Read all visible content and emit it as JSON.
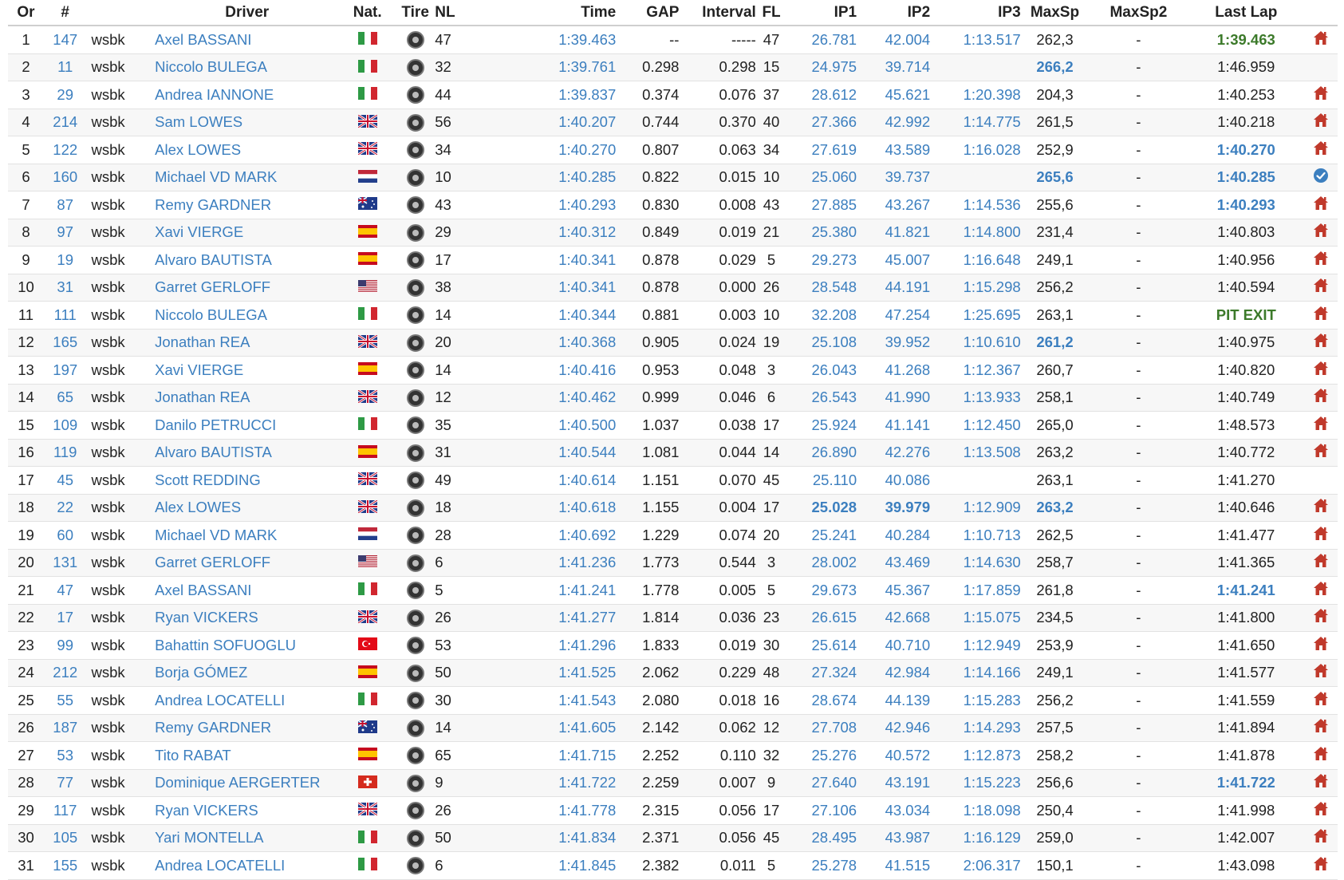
{
  "headers": [
    "Or",
    "#",
    "",
    "Driver",
    "Nat.",
    "Tire",
    "NL",
    "Time",
    "GAP",
    "Interval",
    "FL",
    "IP1",
    "IP2",
    "IP3",
    "MaxSp",
    "MaxSp2",
    "Last Lap",
    ""
  ],
  "colors": {
    "link": "#3c7fbf",
    "green": "#3c7a2a",
    "home": "#c0392b",
    "check": "#3c7fbf"
  },
  "flags": {
    "IT": [
      "#2e9a45",
      "#ffffff",
      "#d1262f"
    ],
    "GB": "gb",
    "NL": [
      "#c0283a",
      "#ffffff",
      "#233f8c"
    ],
    "AU": "au",
    "ES": [
      "#c60b1e",
      "#ffc400",
      "#c60b1e"
    ],
    "US": "us",
    "TR": "tr",
    "CH": "ch"
  },
  "rows": [
    {
      "pos": "1",
      "num": "147",
      "cat": "wsbk",
      "driver": "Axel BASSANI",
      "nat": "IT",
      "nl": "47",
      "time": "1:39.463",
      "gap": "--",
      "interval": "-----",
      "fl": "47",
      "ip1": "26.781",
      "ip2": "42.004",
      "ip3": "1:13.517",
      "maxsp": "262,3",
      "maxsp2": "-",
      "lastlap": "1:39.463",
      "ll_style": "green",
      "ms_style": "",
      "ip1_style": "",
      "ip2_style": "",
      "icon": "home-icon"
    },
    {
      "pos": "2",
      "num": "11",
      "cat": "wsbk",
      "driver": "Niccolo BULEGA",
      "nat": "IT",
      "nl": "32",
      "time": "1:39.761",
      "gap": "0.298",
      "interval": "0.298",
      "fl": "15",
      "ip1": "24.975",
      "ip2": "39.714",
      "ip3": "",
      "maxsp": "266,2",
      "maxsp2": "-",
      "lastlap": "1:46.959",
      "ll_style": "",
      "ms_style": "hl",
      "ip1_style": "",
      "ip2_style": "",
      "icon": ""
    },
    {
      "pos": "3",
      "num": "29",
      "cat": "wsbk",
      "driver": "Andrea IANNONE",
      "nat": "IT",
      "nl": "44",
      "time": "1:39.837",
      "gap": "0.374",
      "interval": "0.076",
      "fl": "37",
      "ip1": "28.612",
      "ip2": "45.621",
      "ip3": "1:20.398",
      "maxsp": "204,3",
      "maxsp2": "-",
      "lastlap": "1:40.253",
      "ll_style": "",
      "ms_style": "",
      "ip1_style": "",
      "ip2_style": "",
      "icon": "home-icon"
    },
    {
      "pos": "4",
      "num": "214",
      "cat": "wsbk",
      "driver": "Sam LOWES",
      "nat": "GB",
      "nl": "56",
      "time": "1:40.207",
      "gap": "0.744",
      "interval": "0.370",
      "fl": "40",
      "ip1": "27.366",
      "ip2": "42.992",
      "ip3": "1:14.775",
      "maxsp": "261,5",
      "maxsp2": "-",
      "lastlap": "1:40.218",
      "ll_style": "",
      "ms_style": "",
      "ip1_style": "",
      "ip2_style": "",
      "icon": "home-icon"
    },
    {
      "pos": "5",
      "num": "122",
      "cat": "wsbk",
      "driver": "Alex LOWES",
      "nat": "GB",
      "nl": "34",
      "time": "1:40.270",
      "gap": "0.807",
      "interval": "0.063",
      "fl": "34",
      "ip1": "27.619",
      "ip2": "43.589",
      "ip3": "1:16.028",
      "maxsp": "252,9",
      "maxsp2": "-",
      "lastlap": "1:40.270",
      "ll_style": "hl",
      "ms_style": "",
      "ip1_style": "",
      "ip2_style": "",
      "icon": "home-icon"
    },
    {
      "pos": "6",
      "num": "160",
      "cat": "wsbk",
      "driver": "Michael VD MARK",
      "nat": "NL",
      "nl": "10",
      "time": "1:40.285",
      "gap": "0.822",
      "interval": "0.015",
      "fl": "10",
      "ip1": "25.060",
      "ip2": "39.737",
      "ip3": "",
      "maxsp": "265,6",
      "maxsp2": "-",
      "lastlap": "1:40.285",
      "ll_style": "hl",
      "ms_style": "hl",
      "ip1_style": "",
      "ip2_style": "",
      "icon": "check-icon"
    },
    {
      "pos": "7",
      "num": "87",
      "cat": "wsbk",
      "driver": "Remy GARDNER",
      "nat": "AU",
      "nl": "43",
      "time": "1:40.293",
      "gap": "0.830",
      "interval": "0.008",
      "fl": "43",
      "ip1": "27.885",
      "ip2": "43.267",
      "ip3": "1:14.536",
      "maxsp": "255,6",
      "maxsp2": "-",
      "lastlap": "1:40.293",
      "ll_style": "hl",
      "ms_style": "",
      "ip1_style": "",
      "ip2_style": "",
      "icon": "home-icon"
    },
    {
      "pos": "8",
      "num": "97",
      "cat": "wsbk",
      "driver": "Xavi VIERGE",
      "nat": "ES",
      "nl": "29",
      "time": "1:40.312",
      "gap": "0.849",
      "interval": "0.019",
      "fl": "21",
      "ip1": "25.380",
      "ip2": "41.821",
      "ip3": "1:14.800",
      "maxsp": "231,4",
      "maxsp2": "-",
      "lastlap": "1:40.803",
      "ll_style": "",
      "ms_style": "",
      "ip1_style": "",
      "ip2_style": "",
      "icon": "home-icon"
    },
    {
      "pos": "9",
      "num": "19",
      "cat": "wsbk",
      "driver": "Alvaro BAUTISTA",
      "nat": "ES",
      "nl": "17",
      "time": "1:40.341",
      "gap": "0.878",
      "interval": "0.029",
      "fl": "5",
      "ip1": "29.273",
      "ip2": "45.007",
      "ip3": "1:16.648",
      "maxsp": "249,1",
      "maxsp2": "-",
      "lastlap": "1:40.956",
      "ll_style": "",
      "ms_style": "",
      "ip1_style": "",
      "ip2_style": "",
      "icon": "home-icon"
    },
    {
      "pos": "10",
      "num": "31",
      "cat": "wsbk",
      "driver": "Garret GERLOFF",
      "nat": "US",
      "nl": "38",
      "time": "1:40.341",
      "gap": "0.878",
      "interval": "0.000",
      "fl": "26",
      "ip1": "28.548",
      "ip2": "44.191",
      "ip3": "1:15.298",
      "maxsp": "256,2",
      "maxsp2": "-",
      "lastlap": "1:40.594",
      "ll_style": "",
      "ms_style": "",
      "ip1_style": "",
      "ip2_style": "",
      "icon": "home-icon"
    },
    {
      "pos": "11",
      "num": "111",
      "cat": "wsbk",
      "driver": "Niccolo BULEGA",
      "nat": "IT",
      "nl": "14",
      "time": "1:40.344",
      "gap": "0.881",
      "interval": "0.003",
      "fl": "10",
      "ip1": "32.208",
      "ip2": "47.254",
      "ip3": "1:25.695",
      "maxsp": "263,1",
      "maxsp2": "-",
      "lastlap": "PIT EXIT",
      "ll_style": "pit",
      "ms_style": "",
      "ip1_style": "",
      "ip2_style": "",
      "icon": "home-icon"
    },
    {
      "pos": "12",
      "num": "165",
      "cat": "wsbk",
      "driver": "Jonathan REA",
      "nat": "GB",
      "nl": "20",
      "time": "1:40.368",
      "gap": "0.905",
      "interval": "0.024",
      "fl": "19",
      "ip1": "25.108",
      "ip2": "39.952",
      "ip3": "1:10.610",
      "maxsp": "261,2",
      "maxsp2": "-",
      "lastlap": "1:40.975",
      "ll_style": "",
      "ms_style": "hl",
      "ip1_style": "",
      "ip2_style": "",
      "icon": "home-icon"
    },
    {
      "pos": "13",
      "num": "197",
      "cat": "wsbk",
      "driver": "Xavi VIERGE",
      "nat": "ES",
      "nl": "14",
      "time": "1:40.416",
      "gap": "0.953",
      "interval": "0.048",
      "fl": "3",
      "ip1": "26.043",
      "ip2": "41.268",
      "ip3": "1:12.367",
      "maxsp": "260,7",
      "maxsp2": "-",
      "lastlap": "1:40.820",
      "ll_style": "",
      "ms_style": "",
      "ip1_style": "",
      "ip2_style": "",
      "icon": "home-icon"
    },
    {
      "pos": "14",
      "num": "65",
      "cat": "wsbk",
      "driver": "Jonathan REA",
      "nat": "GB",
      "nl": "12",
      "time": "1:40.462",
      "gap": "0.999",
      "interval": "0.046",
      "fl": "6",
      "ip1": "26.543",
      "ip2": "41.990",
      "ip3": "1:13.933",
      "maxsp": "258,1",
      "maxsp2": "-",
      "lastlap": "1:40.749",
      "ll_style": "",
      "ms_style": "",
      "ip1_style": "",
      "ip2_style": "",
      "icon": "home-icon"
    },
    {
      "pos": "15",
      "num": "109",
      "cat": "wsbk",
      "driver": "Danilo PETRUCCI",
      "nat": "IT",
      "nl": "35",
      "time": "1:40.500",
      "gap": "1.037",
      "interval": "0.038",
      "fl": "17",
      "ip1": "25.924",
      "ip2": "41.141",
      "ip3": "1:12.450",
      "maxsp": "265,0",
      "maxsp2": "-",
      "lastlap": "1:48.573",
      "ll_style": "",
      "ms_style": "",
      "ip1_style": "",
      "ip2_style": "",
      "icon": "home-icon"
    },
    {
      "pos": "16",
      "num": "119",
      "cat": "wsbk",
      "driver": "Alvaro BAUTISTA",
      "nat": "ES",
      "nl": "31",
      "time": "1:40.544",
      "gap": "1.081",
      "interval": "0.044",
      "fl": "14",
      "ip1": "26.890",
      "ip2": "42.276",
      "ip3": "1:13.508",
      "maxsp": "263,2",
      "maxsp2": "-",
      "lastlap": "1:40.772",
      "ll_style": "",
      "ms_style": "",
      "ip1_style": "",
      "ip2_style": "",
      "icon": "home-icon"
    },
    {
      "pos": "17",
      "num": "45",
      "cat": "wsbk",
      "driver": "Scott REDDING",
      "nat": "GB",
      "nl": "49",
      "time": "1:40.614",
      "gap": "1.151",
      "interval": "0.070",
      "fl": "45",
      "ip1": "25.110",
      "ip2": "40.086",
      "ip3": "",
      "maxsp": "263,1",
      "maxsp2": "-",
      "lastlap": "1:41.270",
      "ll_style": "",
      "ms_style": "",
      "ip1_style": "",
      "ip2_style": "",
      "icon": ""
    },
    {
      "pos": "18",
      "num": "22",
      "cat": "wsbk",
      "driver": "Alex LOWES",
      "nat": "GB",
      "nl": "18",
      "time": "1:40.618",
      "gap": "1.155",
      "interval": "0.004",
      "fl": "17",
      "ip1": "25.028",
      "ip2": "39.979",
      "ip3": "1:12.909",
      "maxsp": "263,2",
      "maxsp2": "-",
      "lastlap": "1:40.646",
      "ll_style": "",
      "ms_style": "hl",
      "ip1_style": "hl",
      "ip2_style": "hl",
      "icon": "home-icon"
    },
    {
      "pos": "19",
      "num": "60",
      "cat": "wsbk",
      "driver": "Michael VD MARK",
      "nat": "NL",
      "nl": "28",
      "time": "1:40.692",
      "gap": "1.229",
      "interval": "0.074",
      "fl": "20",
      "ip1": "25.241",
      "ip2": "40.284",
      "ip3": "1:10.713",
      "maxsp": "262,5",
      "maxsp2": "-",
      "lastlap": "1:41.477",
      "ll_style": "",
      "ms_style": "",
      "ip1_style": "",
      "ip2_style": "",
      "icon": "home-icon"
    },
    {
      "pos": "20",
      "num": "131",
      "cat": "wsbk",
      "driver": "Garret GERLOFF",
      "nat": "US",
      "nl": "6",
      "time": "1:41.236",
      "gap": "1.773",
      "interval": "0.544",
      "fl": "3",
      "ip1": "28.002",
      "ip2": "43.469",
      "ip3": "1:14.630",
      "maxsp": "258,7",
      "maxsp2": "-",
      "lastlap": "1:41.365",
      "ll_style": "",
      "ms_style": "",
      "ip1_style": "",
      "ip2_style": "",
      "icon": "home-icon"
    },
    {
      "pos": "21",
      "num": "47",
      "cat": "wsbk",
      "driver": "Axel BASSANI",
      "nat": "IT",
      "nl": "5",
      "time": "1:41.241",
      "gap": "1.778",
      "interval": "0.005",
      "fl": "5",
      "ip1": "29.673",
      "ip2": "45.367",
      "ip3": "1:17.859",
      "maxsp": "261,8",
      "maxsp2": "-",
      "lastlap": "1:41.241",
      "ll_style": "hl",
      "ms_style": "",
      "ip1_style": "",
      "ip2_style": "",
      "icon": "home-icon"
    },
    {
      "pos": "22",
      "num": "17",
      "cat": "wsbk",
      "driver": "Ryan VICKERS",
      "nat": "GB",
      "nl": "26",
      "time": "1:41.277",
      "gap": "1.814",
      "interval": "0.036",
      "fl": "23",
      "ip1": "26.615",
      "ip2": "42.668",
      "ip3": "1:15.075",
      "maxsp": "234,5",
      "maxsp2": "-",
      "lastlap": "1:41.800",
      "ll_style": "",
      "ms_style": "",
      "ip1_style": "",
      "ip2_style": "",
      "icon": "home-icon"
    },
    {
      "pos": "23",
      "num": "99",
      "cat": "wsbk",
      "driver": "Bahattin SOFUOGLU",
      "nat": "TR",
      "nl": "53",
      "time": "1:41.296",
      "gap": "1.833",
      "interval": "0.019",
      "fl": "30",
      "ip1": "25.614",
      "ip2": "40.710",
      "ip3": "1:12.949",
      "maxsp": "253,9",
      "maxsp2": "-",
      "lastlap": "1:41.650",
      "ll_style": "",
      "ms_style": "",
      "ip1_style": "",
      "ip2_style": "",
      "icon": "home-icon"
    },
    {
      "pos": "24",
      "num": "212",
      "cat": "wsbk",
      "driver": "Borja GÓMEZ",
      "nat": "ES",
      "nl": "50",
      "time": "1:41.525",
      "gap": "2.062",
      "interval": "0.229",
      "fl": "48",
      "ip1": "27.324",
      "ip2": "42.984",
      "ip3": "1:14.166",
      "maxsp": "249,1",
      "maxsp2": "-",
      "lastlap": "1:41.577",
      "ll_style": "",
      "ms_style": "",
      "ip1_style": "",
      "ip2_style": "",
      "icon": "home-icon"
    },
    {
      "pos": "25",
      "num": "55",
      "cat": "wsbk",
      "driver": "Andrea LOCATELLI",
      "nat": "IT",
      "nl": "30",
      "time": "1:41.543",
      "gap": "2.080",
      "interval": "0.018",
      "fl": "16",
      "ip1": "28.674",
      "ip2": "44.139",
      "ip3": "1:15.283",
      "maxsp": "256,2",
      "maxsp2": "-",
      "lastlap": "1:41.559",
      "ll_style": "",
      "ms_style": "",
      "ip1_style": "",
      "ip2_style": "",
      "icon": "home-icon"
    },
    {
      "pos": "26",
      "num": "187",
      "cat": "wsbk",
      "driver": "Remy GARDNER",
      "nat": "AU",
      "nl": "14",
      "time": "1:41.605",
      "gap": "2.142",
      "interval": "0.062",
      "fl": "12",
      "ip1": "27.708",
      "ip2": "42.946",
      "ip3": "1:14.293",
      "maxsp": "257,5",
      "maxsp2": "-",
      "lastlap": "1:41.894",
      "ll_style": "",
      "ms_style": "",
      "ip1_style": "",
      "ip2_style": "",
      "icon": "home-icon"
    },
    {
      "pos": "27",
      "num": "53",
      "cat": "wsbk",
      "driver": "Tito RABAT",
      "nat": "ES",
      "nl": "65",
      "time": "1:41.715",
      "gap": "2.252",
      "interval": "0.110",
      "fl": "32",
      "ip1": "25.276",
      "ip2": "40.572",
      "ip3": "1:12.873",
      "maxsp": "258,2",
      "maxsp2": "-",
      "lastlap": "1:41.878",
      "ll_style": "",
      "ms_style": "",
      "ip1_style": "",
      "ip2_style": "",
      "icon": "home-icon"
    },
    {
      "pos": "28",
      "num": "77",
      "cat": "wsbk",
      "driver": "Dominique AERGERTER",
      "nat": "CH",
      "nl": "9",
      "time": "1:41.722",
      "gap": "2.259",
      "interval": "0.007",
      "fl": "9",
      "ip1": "27.640",
      "ip2": "43.191",
      "ip3": "1:15.223",
      "maxsp": "256,6",
      "maxsp2": "-",
      "lastlap": "1:41.722",
      "ll_style": "hl",
      "ms_style": "",
      "ip1_style": "",
      "ip2_style": "",
      "icon": "home-icon"
    },
    {
      "pos": "29",
      "num": "117",
      "cat": "wsbk",
      "driver": "Ryan VICKERS",
      "nat": "GB",
      "nl": "26",
      "time": "1:41.778",
      "gap": "2.315",
      "interval": "0.056",
      "fl": "17",
      "ip1": "27.106",
      "ip2": "43.034",
      "ip3": "1:18.098",
      "maxsp": "250,4",
      "maxsp2": "-",
      "lastlap": "1:41.998",
      "ll_style": "",
      "ms_style": "",
      "ip1_style": "",
      "ip2_style": "",
      "icon": "home-icon"
    },
    {
      "pos": "30",
      "num": "105",
      "cat": "wsbk",
      "driver": "Yari MONTELLA",
      "nat": "IT",
      "nl": "50",
      "time": "1:41.834",
      "gap": "2.371",
      "interval": "0.056",
      "fl": "45",
      "ip1": "28.495",
      "ip2": "43.987",
      "ip3": "1:16.129",
      "maxsp": "259,0",
      "maxsp2": "-",
      "lastlap": "1:42.007",
      "ll_style": "",
      "ms_style": "",
      "ip1_style": "",
      "ip2_style": "",
      "icon": "home-icon"
    },
    {
      "pos": "31",
      "num": "155",
      "cat": "wsbk",
      "driver": "Andrea LOCATELLI",
      "nat": "IT",
      "nl": "6",
      "time": "1:41.845",
      "gap": "2.382",
      "interval": "0.011",
      "fl": "5",
      "ip1": "25.278",
      "ip2": "41.515",
      "ip3": "2:06.317",
      "maxsp": "150,1",
      "maxsp2": "-",
      "lastlap": "1:43.098",
      "ll_style": "",
      "ms_style": "",
      "ip1_style": "",
      "ip2_style": "",
      "icon": "home-icon"
    }
  ]
}
